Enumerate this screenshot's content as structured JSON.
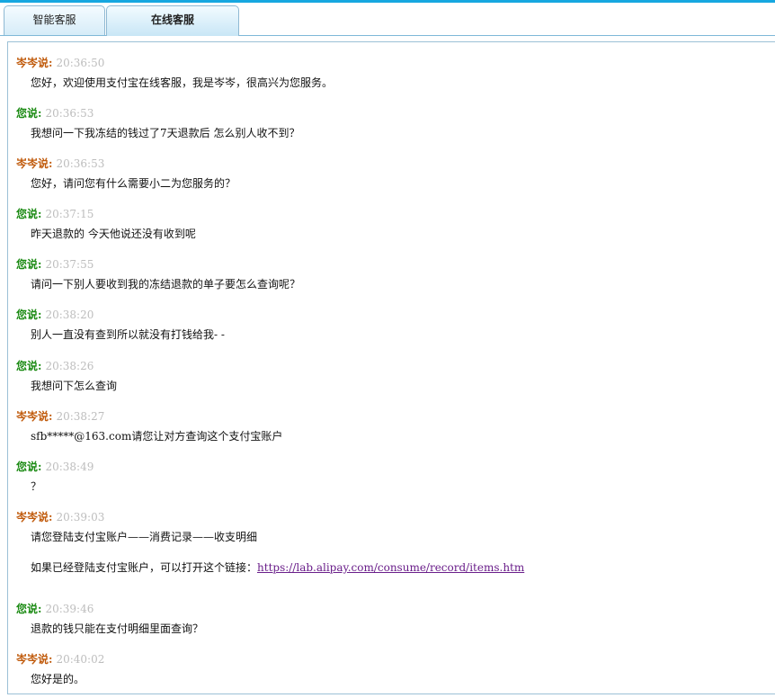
{
  "tabs": [
    {
      "label": "智能客服",
      "active": false
    },
    {
      "label": "在线客服",
      "active": true
    }
  ],
  "colors": {
    "agent_name": "#c05a0b",
    "user_name": "#1a8a12",
    "timestamp": "#bdbdbd",
    "accent_line": "#16a7e0",
    "link": "#6a1e8a"
  },
  "messages": [
    {
      "sender": "岑岑说:",
      "role": "agent",
      "time": "20:36:50",
      "lines": [
        "您好，欢迎使用支付宝在线客服，我是岑岑，很高兴为您服务。"
      ]
    },
    {
      "sender": "您说:",
      "role": "user",
      "time": "20:36:53",
      "lines": [
        "我想问一下我冻结的钱过了7天退款后  怎么别人收不到？"
      ]
    },
    {
      "sender": "岑岑说:",
      "role": "agent",
      "time": "20:36:53",
      "lines": [
        "您好，请问您有什么需要小二为您服务的？"
      ]
    },
    {
      "sender": "您说:",
      "role": "user",
      "time": "20:37:15",
      "lines": [
        "昨天退款的  今天他说还没有收到呢"
      ]
    },
    {
      "sender": "您说:",
      "role": "user",
      "time": "20:37:55",
      "lines": [
        "请问一下别人要收到我的冻结退款的单子要怎么查询呢？"
      ]
    },
    {
      "sender": "您说:",
      "role": "user",
      "time": "20:38:20",
      "lines": [
        "别人一直没有查到所以就没有打钱给我- -"
      ]
    },
    {
      "sender": "您说:",
      "role": "user",
      "time": "20:38:26",
      "lines": [
        "我想问下怎么查询"
      ]
    },
    {
      "sender": "岑岑说:",
      "role": "agent",
      "time": "20:38:27",
      "lines": [
        "sfb*****@163.com请您让对方查询这个支付宝账户"
      ]
    },
    {
      "sender": "您说:",
      "role": "user",
      "time": "20:38:49",
      "lines": [
        "？"
      ]
    },
    {
      "sender": "岑岑说:",
      "role": "agent",
      "time": "20:39:03",
      "lines": [
        "请您登陆支付宝账户——消费记录——收支明细"
      ],
      "extra": {
        "text": "如果已经登陆支付宝账户，可以打开这个链接：",
        "link": "https://lab.alipay.com/consume/record/items.htm"
      }
    },
    {
      "sender": "您说:",
      "role": "user",
      "time": "20:39:46",
      "lines": [
        "退款的钱只能在支付明细里面查询？"
      ]
    },
    {
      "sender": "岑岑说:",
      "role": "agent",
      "time": "20:40:02",
      "lines": [
        "您好是的。"
      ]
    }
  ]
}
